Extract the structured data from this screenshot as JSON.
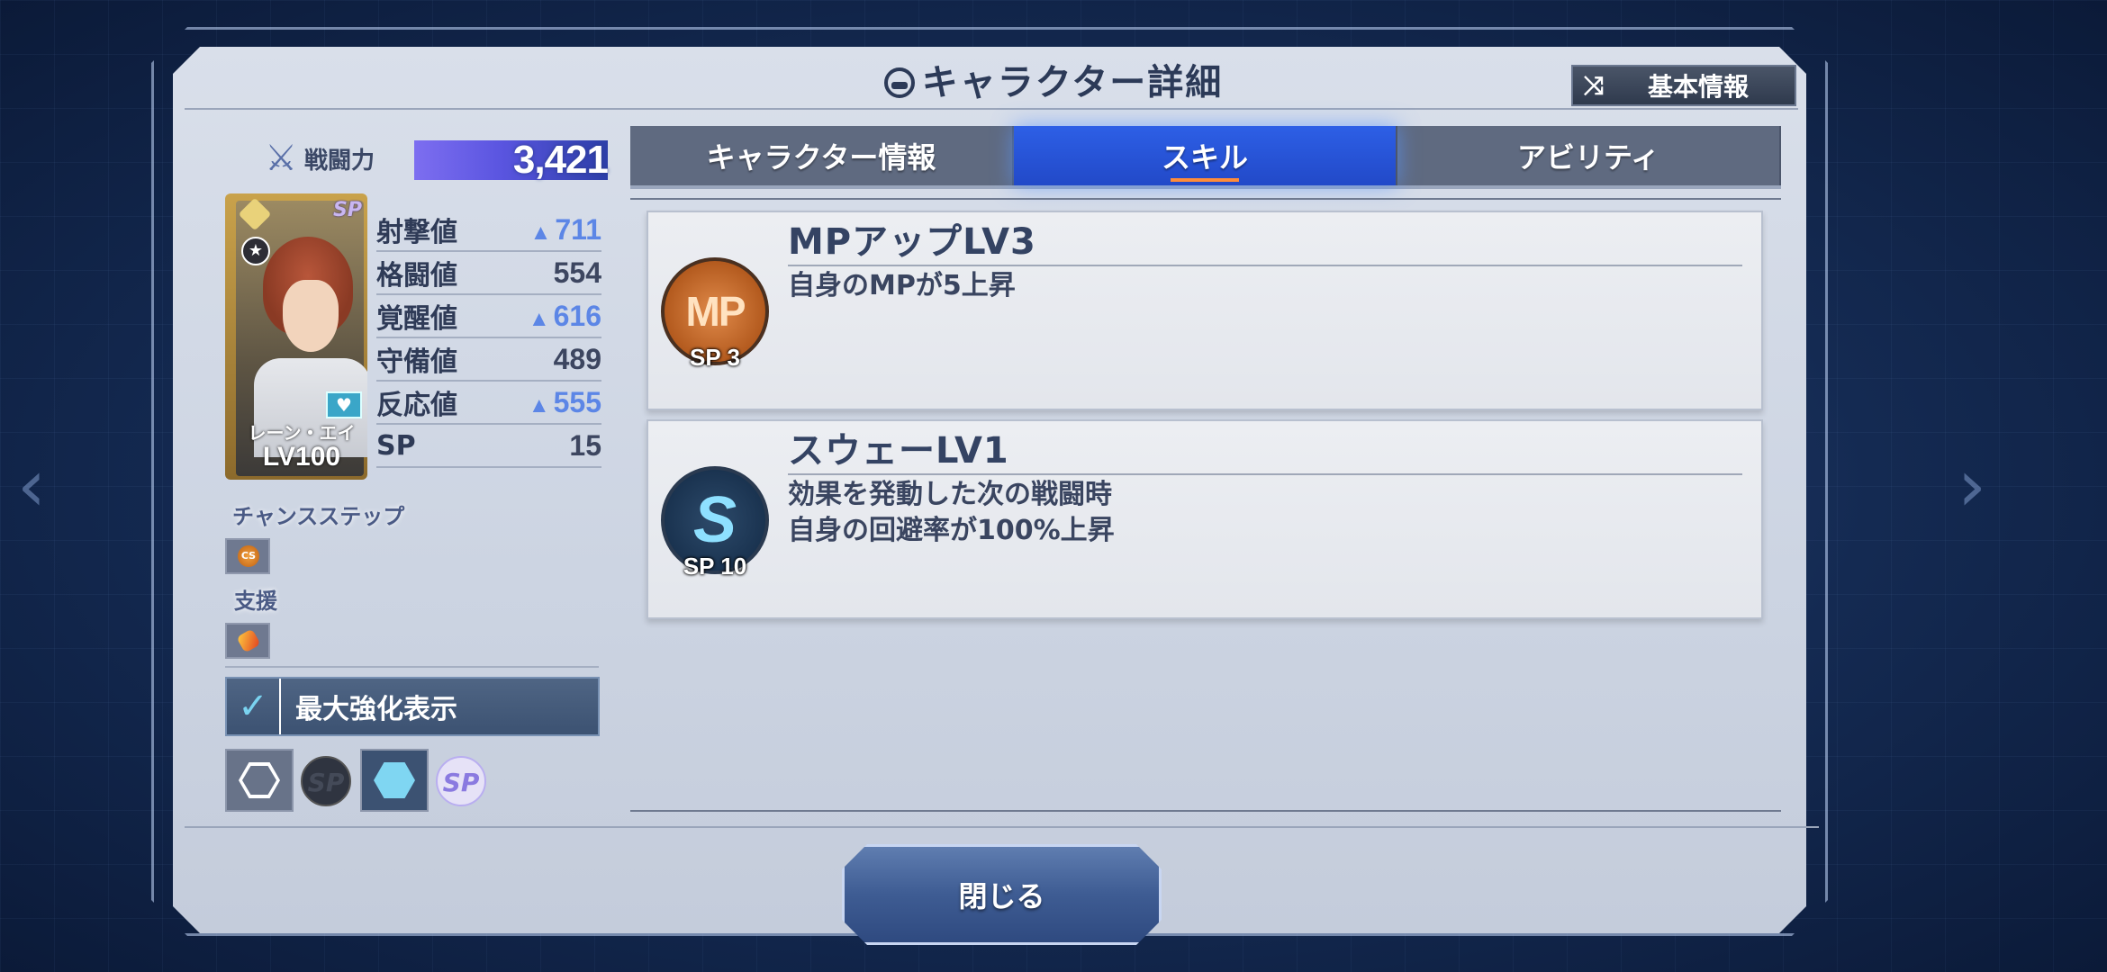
{
  "header": {
    "title": "キャラクター詳細",
    "basic_info_label": "基本情報"
  },
  "power": {
    "label": "戦闘力",
    "value": "3,421"
  },
  "character": {
    "name": "レーン・エイ",
    "level": "LV100",
    "sp_mark": "SP"
  },
  "stats": [
    {
      "label": "射撃値",
      "value": "711",
      "boosted": true
    },
    {
      "label": "格闘値",
      "value": "554",
      "boosted": false
    },
    {
      "label": "覚醒値",
      "value": "616",
      "boosted": true
    },
    {
      "label": "守備値",
      "value": "489",
      "boosted": false
    },
    {
      "label": "反応値",
      "value": "555",
      "boosted": true
    },
    {
      "label": "SP",
      "value": "15",
      "boosted": false
    }
  ],
  "sections": {
    "chance_step": "チャンスステップ",
    "chance_step_icon": "CS",
    "support": "支援"
  },
  "max_toggle": {
    "label": "最大強化表示",
    "checked": true
  },
  "filters": {
    "sp_label": "SP"
  },
  "tabs": [
    {
      "label": "キャラクター情報",
      "active": false
    },
    {
      "label": "スキル",
      "active": true
    },
    {
      "label": "アビリティ",
      "active": false
    }
  ],
  "skills": [
    {
      "name": "MPアップLV3",
      "icon_text": "MP",
      "sp": "SP 3",
      "desc_lines": [
        "自身のMPが5上昇"
      ]
    },
    {
      "name": "スウェーLV1",
      "icon_text": "S",
      "sp": "SP 10",
      "desc_lines": [
        "効果を発動した次の戦闘時",
        "自身の回避率が100%上昇"
      ]
    }
  ],
  "close_label": "閉じる",
  "colors": {
    "active_tab": "#2d5fe6",
    "boost_blue": "#5c86e6",
    "panel": "#d9dfea"
  }
}
